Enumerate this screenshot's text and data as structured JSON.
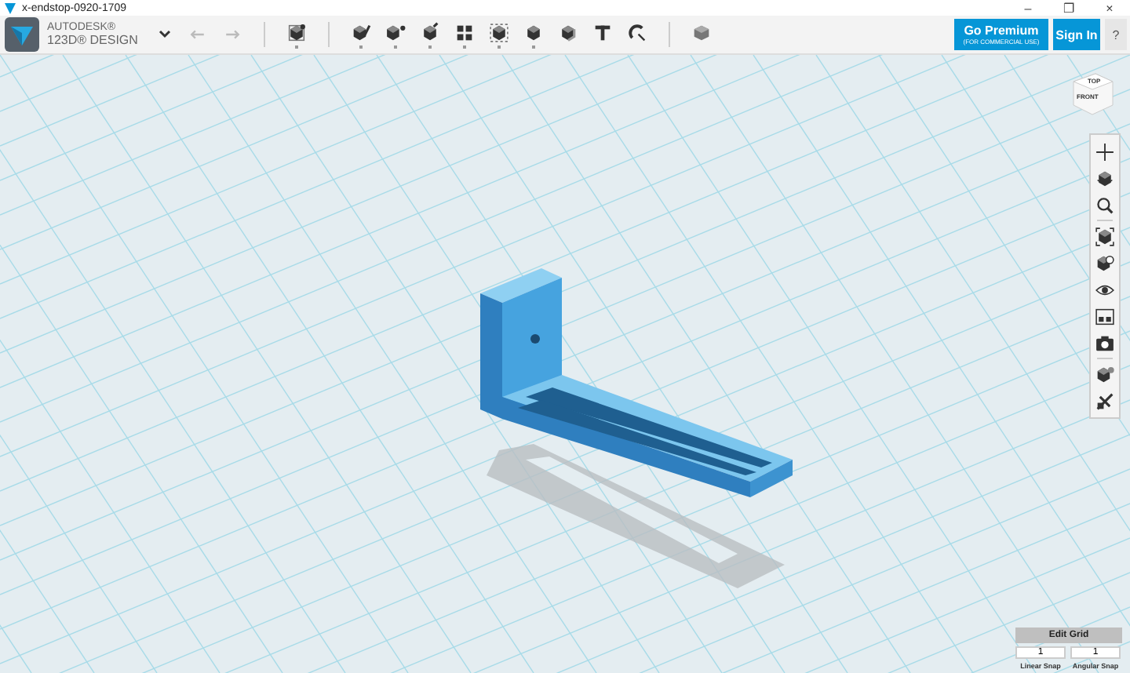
{
  "window": {
    "title": "x-endstop-0920-1709",
    "controls": [
      "–",
      "❐",
      "×"
    ]
  },
  "app": {
    "brand": "AUTODESK®",
    "product": "123D® DESIGN"
  },
  "toolbar": {
    "history": [
      {
        "kind": "undo",
        "disabled": true
      },
      {
        "kind": "redo",
        "disabled": true
      }
    ],
    "groups": [
      [
        {
          "kind": "primitives",
          "dropdown": true
        }
      ],
      [
        {
          "kind": "sketch",
          "dropdown": true
        },
        {
          "kind": "construct",
          "dropdown": true
        },
        {
          "kind": "modify",
          "dropdown": true
        },
        {
          "kind": "pattern",
          "dropdown": true
        },
        {
          "kind": "group",
          "dropdown": true
        },
        {
          "kind": "combine",
          "dropdown": true
        },
        {
          "kind": "measure",
          "dropdown": false
        },
        {
          "kind": "text",
          "dropdown": false
        },
        {
          "kind": "snap",
          "dropdown": false
        }
      ],
      [
        {
          "kind": "material",
          "dropdown": false
        }
      ]
    ]
  },
  "account": {
    "premium_label": "Go Premium",
    "premium_note": "(FOR COMMERCIAL USE)",
    "sign_in": "Sign In",
    "help": "?"
  },
  "view_cube": {
    "top": "TOP",
    "front": "FRONT"
  },
  "navigation": [
    [
      {
        "kind": "pan"
      },
      {
        "kind": "orbit"
      },
      {
        "kind": "zoom"
      }
    ],
    [
      {
        "kind": "fit"
      },
      {
        "kind": "views"
      },
      {
        "kind": "visibility"
      },
      {
        "kind": "materials"
      },
      {
        "kind": "camera"
      }
    ],
    [
      {
        "kind": "grid"
      },
      {
        "kind": "snap"
      }
    ]
  ],
  "grid_panel": {
    "button": "Edit Grid",
    "linear_value": "1",
    "angular_value": "1",
    "linear_label": "Linear Snap",
    "angular_label": "Angular Snap"
  }
}
